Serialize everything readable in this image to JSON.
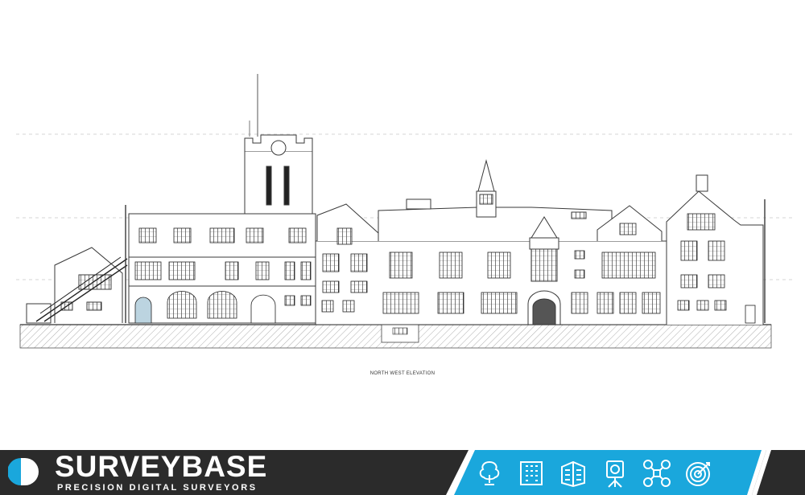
{
  "drawing": {
    "caption": "NORTH WEST ELEVATION",
    "line_color": "#3a3a3a"
  },
  "banner": {
    "brand_name": "SURVEYBASE",
    "tagline": "PRECISION DIGITAL SURVEYORS",
    "dark_color": "#2b2b2b",
    "accent_color": "#1aa7dc",
    "services": [
      {
        "icon": "tree-icon"
      },
      {
        "icon": "building-facade-icon"
      },
      {
        "icon": "building-3d-icon"
      },
      {
        "icon": "laser-scanner-icon"
      },
      {
        "icon": "drone-icon"
      },
      {
        "icon": "target-icon"
      }
    ]
  }
}
